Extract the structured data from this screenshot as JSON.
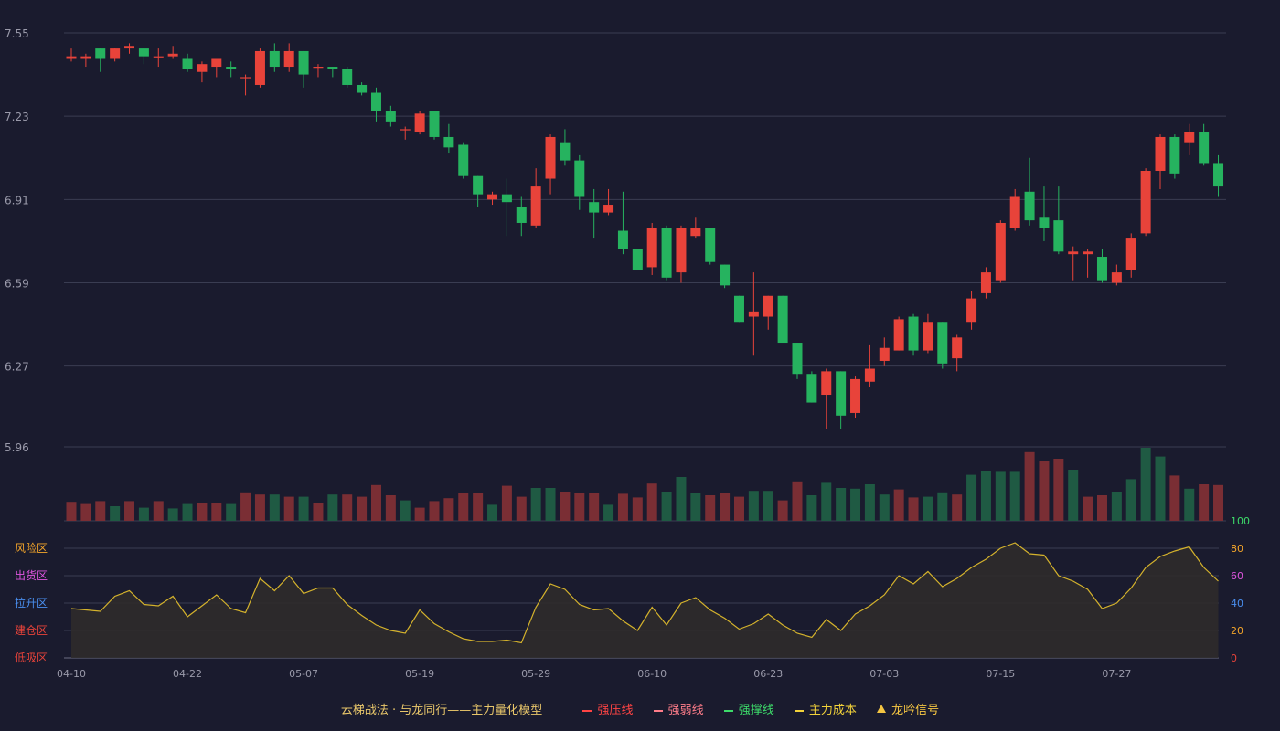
{
  "colors": {
    "background": "#1a1b2e",
    "up": "#e8433a",
    "down": "#26b35f",
    "vol_up": "#7a2e34",
    "vol_down": "#1f5a43",
    "grid": "#3a3d52",
    "axis_text": "#9a9aaa",
    "line": "#d4b22c",
    "area": "#2f2b2b"
  },
  "chart_data": [
    {
      "type": "candlestick",
      "title": "",
      "ylim": [
        5.96,
        7.55
      ],
      "y_ticks": [
        "7.55",
        "7.23",
        "6.91",
        "6.59",
        "6.27",
        "5.96"
      ],
      "x_ticks": [
        "04-10",
        "04-22",
        "05-07",
        "05-19",
        "05-29",
        "06-10",
        "06-23",
        "07-03",
        "07-15",
        "07-27"
      ],
      "x_tick_index": [
        0,
        8,
        16,
        24,
        32,
        40,
        48,
        56,
        64,
        72
      ],
      "ohlc": [
        [
          7.45,
          7.46,
          7.44,
          7.49
        ],
        [
          7.45,
          7.46,
          7.42,
          7.47
        ],
        [
          7.49,
          7.45,
          7.4,
          7.49
        ],
        [
          7.45,
          7.49,
          7.44,
          7.49
        ],
        [
          7.49,
          7.5,
          7.47,
          7.51
        ],
        [
          7.49,
          7.46,
          7.43,
          7.49
        ],
        [
          7.46,
          7.46,
          7.42,
          7.49
        ],
        [
          7.46,
          7.47,
          7.45,
          7.5
        ],
        [
          7.45,
          7.41,
          7.4,
          7.47
        ],
        [
          7.4,
          7.43,
          7.36,
          7.44
        ],
        [
          7.42,
          7.45,
          7.38,
          7.45
        ],
        [
          7.42,
          7.41,
          7.38,
          7.44
        ],
        [
          7.38,
          7.38,
          7.31,
          7.39
        ],
        [
          7.35,
          7.48,
          7.34,
          7.49
        ],
        [
          7.48,
          7.42,
          7.4,
          7.51
        ],
        [
          7.42,
          7.48,
          7.4,
          7.51
        ],
        [
          7.48,
          7.39,
          7.34,
          7.48
        ],
        [
          7.42,
          7.42,
          7.38,
          7.43
        ],
        [
          7.42,
          7.41,
          7.38,
          7.42
        ],
        [
          7.41,
          7.35,
          7.34,
          7.42
        ],
        [
          7.35,
          7.32,
          7.31,
          7.36
        ],
        [
          7.32,
          7.25,
          7.21,
          7.34
        ],
        [
          7.25,
          7.21,
          7.19,
          7.27
        ],
        [
          7.18,
          7.18,
          7.14,
          7.19
        ],
        [
          7.17,
          7.24,
          7.16,
          7.25
        ],
        [
          7.25,
          7.15,
          7.14,
          7.25
        ],
        [
          7.15,
          7.11,
          7.09,
          7.2
        ],
        [
          7.12,
          7.0,
          6.99,
          7.13
        ],
        [
          7.0,
          6.93,
          6.88,
          7.0
        ],
        [
          6.91,
          6.93,
          6.89,
          6.94
        ],
        [
          6.93,
          6.9,
          6.77,
          6.99
        ],
        [
          6.88,
          6.82,
          6.77,
          6.92
        ],
        [
          6.81,
          6.96,
          6.8,
          7.03
        ],
        [
          6.99,
          7.15,
          6.93,
          7.16
        ],
        [
          7.13,
          7.06,
          7.04,
          7.18
        ],
        [
          7.06,
          6.92,
          6.87,
          7.08
        ],
        [
          6.9,
          6.86,
          6.76,
          6.95
        ],
        [
          6.86,
          6.89,
          6.85,
          6.95
        ],
        [
          6.79,
          6.72,
          6.7,
          6.94
        ],
        [
          6.72,
          6.64,
          6.64,
          6.72
        ],
        [
          6.65,
          6.8,
          6.62,
          6.82
        ],
        [
          6.8,
          6.61,
          6.6,
          6.81
        ],
        [
          6.63,
          6.8,
          6.59,
          6.81
        ],
        [
          6.77,
          6.8,
          6.76,
          6.84
        ],
        [
          6.8,
          6.67,
          6.66,
          6.8
        ],
        [
          6.66,
          6.58,
          6.57,
          6.66
        ],
        [
          6.54,
          6.44,
          6.44,
          6.54
        ],
        [
          6.46,
          6.48,
          6.31,
          6.63
        ],
        [
          6.46,
          6.54,
          6.41,
          6.54
        ],
        [
          6.54,
          6.36,
          6.36,
          6.54
        ],
        [
          6.36,
          6.24,
          6.22,
          6.36
        ],
        [
          6.24,
          6.13,
          6.13,
          6.25
        ],
        [
          6.16,
          6.25,
          6.03,
          6.26
        ],
        [
          6.25,
          6.08,
          6.03,
          6.25
        ],
        [
          6.09,
          6.22,
          6.07,
          6.23
        ],
        [
          6.21,
          6.26,
          6.19,
          6.35
        ],
        [
          6.29,
          6.34,
          6.27,
          6.38
        ],
        [
          6.33,
          6.45,
          6.33,
          6.46
        ],
        [
          6.46,
          6.33,
          6.31,
          6.47
        ],
        [
          6.33,
          6.44,
          6.32,
          6.47
        ],
        [
          6.44,
          6.28,
          6.26,
          6.44
        ],
        [
          6.3,
          6.38,
          6.25,
          6.39
        ],
        [
          6.44,
          6.53,
          6.41,
          6.56
        ],
        [
          6.55,
          6.63,
          6.53,
          6.65
        ],
        [
          6.6,
          6.82,
          6.59,
          6.83
        ],
        [
          6.8,
          6.92,
          6.79,
          6.95
        ],
        [
          6.94,
          6.83,
          6.81,
          7.07
        ],
        [
          6.84,
          6.8,
          6.75,
          6.96
        ],
        [
          6.83,
          6.71,
          6.7,
          6.96
        ],
        [
          6.7,
          6.71,
          6.6,
          6.73
        ],
        [
          6.7,
          6.71,
          6.61,
          6.72
        ],
        [
          6.69,
          6.6,
          6.59,
          6.72
        ],
        [
          6.59,
          6.63,
          6.58,
          6.66
        ],
        [
          6.64,
          6.76,
          6.61,
          6.78
        ],
        [
          6.78,
          7.02,
          6.77,
          7.03
        ],
        [
          7.02,
          7.15,
          6.95,
          7.16
        ],
        [
          7.15,
          7.01,
          6.99,
          7.16
        ],
        [
          7.13,
          7.17,
          7.08,
          7.2
        ],
        [
          7.17,
          7.05,
          7.04,
          7.2
        ],
        [
          7.05,
          6.96,
          6.92,
          7.08
        ]
      ]
    },
    {
      "type": "bar",
      "title": "",
      "values": [
        26,
        23,
        27,
        20,
        27,
        18,
        27,
        17,
        23,
        24,
        24,
        23,
        39,
        36,
        36,
        33,
        33,
        24,
        36,
        36,
        33,
        49,
        35,
        28,
        18,
        27,
        31,
        38,
        38,
        22,
        48,
        33,
        45,
        45,
        40,
        38,
        38,
        22,
        37,
        32,
        51,
        40,
        60,
        38,
        35,
        38,
        33,
        41,
        41,
        28,
        54,
        35,
        52,
        45,
        44,
        50,
        36,
        43,
        32,
        33,
        39,
        36,
        63,
        68,
        67,
        67,
        94,
        82,
        85,
        70,
        33,
        35,
        40,
        57,
        100,
        88,
        62,
        44,
        50,
        49
      ],
      "up": [
        1,
        1,
        1,
        0,
        1,
        0,
        1,
        0,
        0,
        1,
        1,
        0,
        1,
        1,
        0,
        1,
        0,
        1,
        0,
        1,
        1,
        1,
        1,
        0,
        1,
        1,
        1,
        1,
        1,
        0,
        1,
        1,
        0,
        0,
        1,
        1,
        1,
        0,
        1,
        1,
        1,
        0,
        0,
        0,
        1,
        1,
        1,
        0,
        0,
        1,
        1,
        0,
        0,
        0,
        0,
        0,
        0,
        1,
        1,
        0,
        0,
        1,
        0,
        0,
        0,
        0,
        1,
        1,
        1,
        0,
        1,
        1,
        0,
        0,
        0,
        0,
        1,
        0,
        1,
        1
      ]
    },
    {
      "type": "area",
      "title": "",
      "ylim": [
        0,
        100
      ],
      "y_ticks": [
        "0",
        "20",
        "40",
        "60",
        "80",
        "100"
      ],
      "zones": [
        "风险区",
        "出货区",
        "拉升区",
        "建仓区",
        "低吸区"
      ],
      "zone_colors": [
        "#f4a52a",
        "#e055e0",
        "#4a8ff0",
        "#e8433a",
        "#e8433a"
      ],
      "y_tick_colors": [
        "#e8433a",
        "#f4a52a",
        "#4a8ff0",
        "#e055e0",
        "#f4a52a",
        "#3ddb6a"
      ],
      "values": [
        36,
        35,
        34,
        45,
        49,
        39,
        38,
        45,
        30,
        38,
        46,
        36,
        33,
        58,
        49,
        60,
        47,
        51,
        51,
        39,
        31,
        24,
        20,
        18,
        35,
        25,
        19,
        14,
        12,
        12,
        13,
        11,
        37,
        54,
        50,
        39,
        35,
        36,
        27,
        20,
        37,
        24,
        40,
        44,
        35,
        29,
        21,
        25,
        32,
        24,
        18,
        15,
        28,
        20,
        32,
        38,
        46,
        60,
        54,
        63,
        52,
        58,
        66,
        72,
        80,
        84,
        76,
        75,
        60,
        56,
        50,
        36,
        40,
        51,
        66,
        74,
        78,
        81,
        66,
        56
      ]
    }
  ],
  "legend": {
    "title": "云梯战法 · 与龙同行——主力量化模型",
    "items": [
      {
        "label": "强压线",
        "color": "#ff4444",
        "style": "solid"
      },
      {
        "label": "强弱线",
        "color": "#ff7d8a",
        "style": "dash"
      },
      {
        "label": "强撑线",
        "color": "#3ddb6a",
        "style": "solid"
      },
      {
        "label": "主力成本",
        "color": "#f2d23a",
        "style": "dash"
      },
      {
        "label": "龙吟信号",
        "color": "#f4c542",
        "style": "triangle"
      }
    ]
  }
}
